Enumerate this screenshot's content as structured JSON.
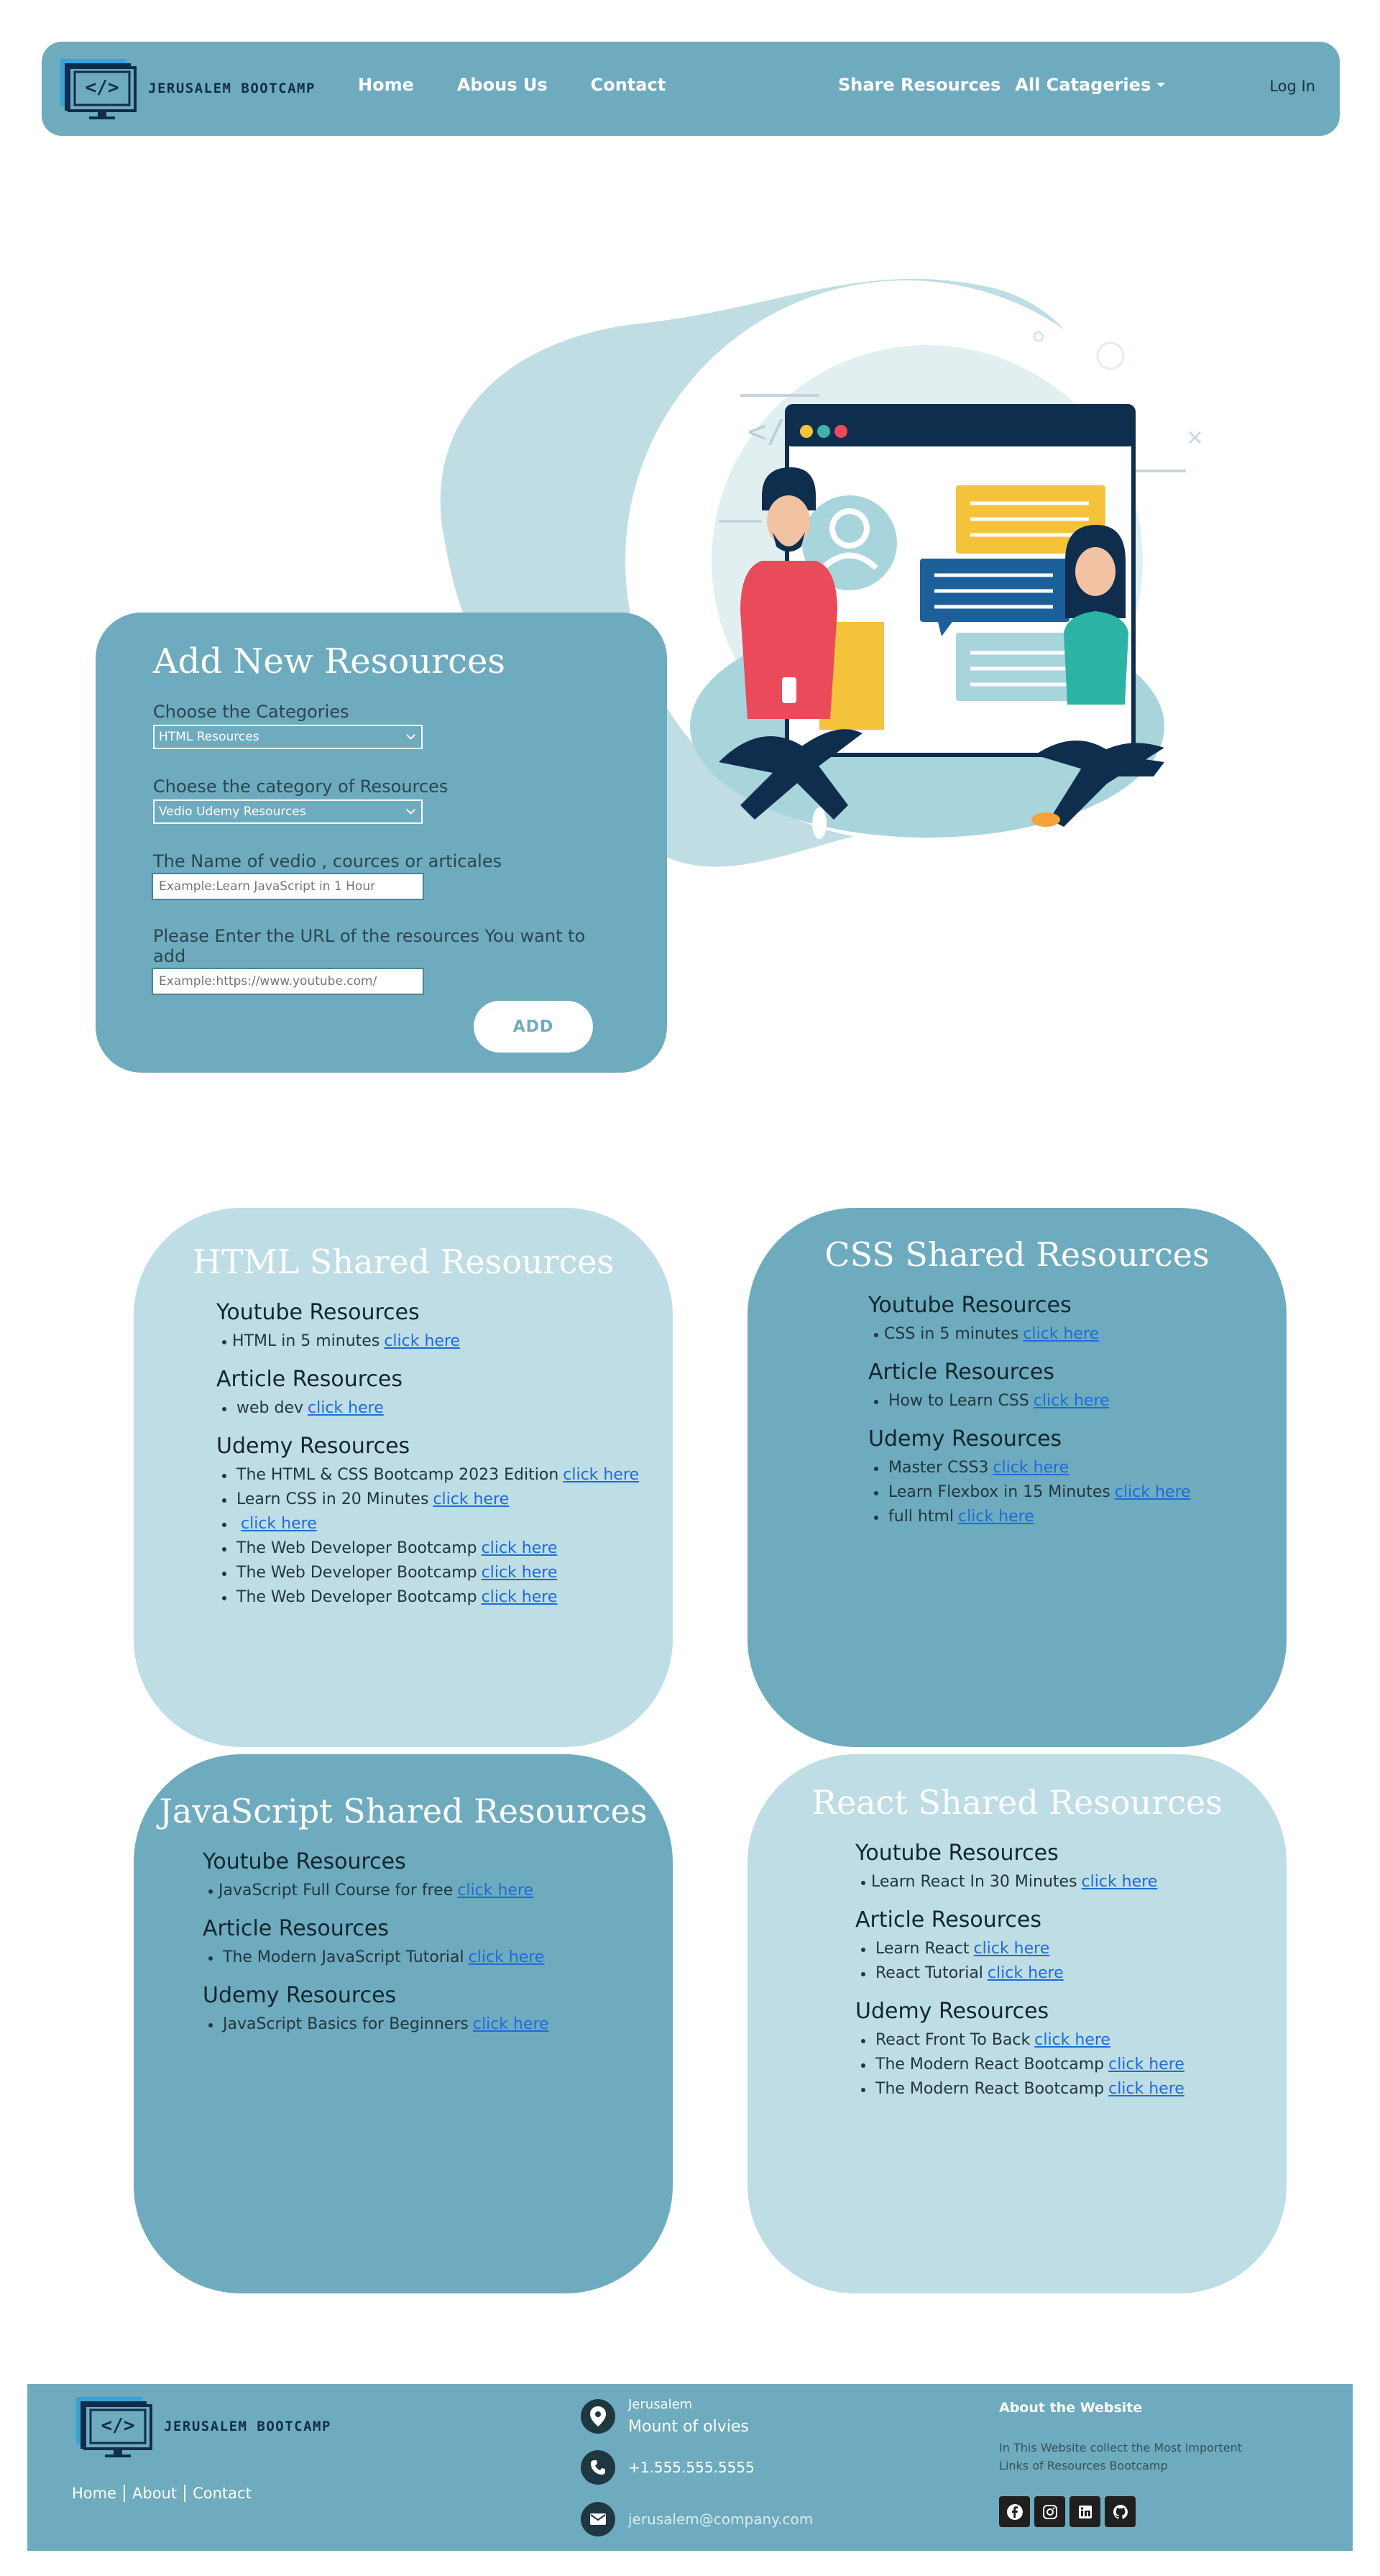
{
  "brand": {
    "logo_text": "</>",
    "name": "JERUSALEM BOOTCAMP"
  },
  "nav": {
    "links": [
      "Home",
      "Abous Us",
      "Contact"
    ],
    "share": "Share Resources",
    "categories": "All Catageries",
    "login": "Log In"
  },
  "form": {
    "title": "Add New Resources",
    "category_label": "Choose the Categories",
    "category_value": "HTML Resources",
    "subcategory_label": "Choese the category of Resources",
    "subcategory_value": "Vedio Udemy Resources",
    "name_label": "The Name of vedio , cources or articales",
    "name_placeholder": "Example:Learn JavaScript in 1 Hour",
    "url_label": "Please Enter the URL of the resources You want to add",
    "url_placeholder": "Example:https://www.youtube.com/",
    "add_button": "ADD"
  },
  "resources": {
    "link_label": "click here",
    "html": {
      "title": "HTML Shared Resources",
      "youtube_title": "Youtube Resources",
      "youtube": [
        "HTML in 5 minutes"
      ],
      "article_title": "Article Resources",
      "articles": [
        "web dev"
      ],
      "udemy_title": "Udemy Resources",
      "udemy": [
        "The HTML & CSS Bootcamp 2023 Edition",
        "Learn CSS in 20 Minutes",
        "",
        "The Web Developer Bootcamp",
        "The Web Developer Bootcamp",
        "The Web Developer Bootcamp"
      ]
    },
    "css": {
      "title": "CSS Shared Resources",
      "youtube_title": "Youtube Resources",
      "youtube": [
        "CSS in 5 minutes"
      ],
      "article_title": "Article Resources",
      "articles": [
        "How to Learn CSS"
      ],
      "udemy_title": "Udemy Resources",
      "udemy": [
        "Master CSS3",
        "Learn Flexbox in 15 Minutes",
        "full html"
      ]
    },
    "js": {
      "title": "JavaScript Shared Resources",
      "youtube_title": "Youtube Resources",
      "youtube": [
        "JavaScript Full Course for free"
      ],
      "article_title": "Article Resources",
      "articles": [
        "The Modern JavaScript Tutorial"
      ],
      "udemy_title": "Udemy Resources",
      "udemy": [
        "JavaScript Basics for Beginners"
      ]
    },
    "react": {
      "title": "React Shared Resources",
      "youtube_title": "Youtube Resources",
      "youtube": [
        "Learn React In 30 Minutes"
      ],
      "article_title": "Article Resources",
      "articles": [
        "Learn React",
        "React Tutorial"
      ],
      "udemy_title": "Udemy Resources",
      "udemy": [
        "React Front To Back",
        "The Modern React Bootcamp",
        "The Modern React Bootcamp"
      ]
    }
  },
  "footer": {
    "links": [
      "Home",
      "About",
      "Contact"
    ],
    "address_line1": "Jerusalem",
    "address_line2": "Mount of olvies",
    "phone": "+1.555.555.5555",
    "email": "jerusalem@company.com",
    "about_title": "About the Website",
    "about_text": "In This Website collect the Most Importent Links of Resources Bootcamp",
    "socials": [
      "facebook-icon",
      "instagram-icon",
      "linkedin-icon",
      "github-icon"
    ]
  },
  "colors": {
    "primary": "#6eabbe",
    "light": "#bfdde4",
    "dark_navy": "#0f2d4d",
    "link": "#1f6cd6"
  }
}
